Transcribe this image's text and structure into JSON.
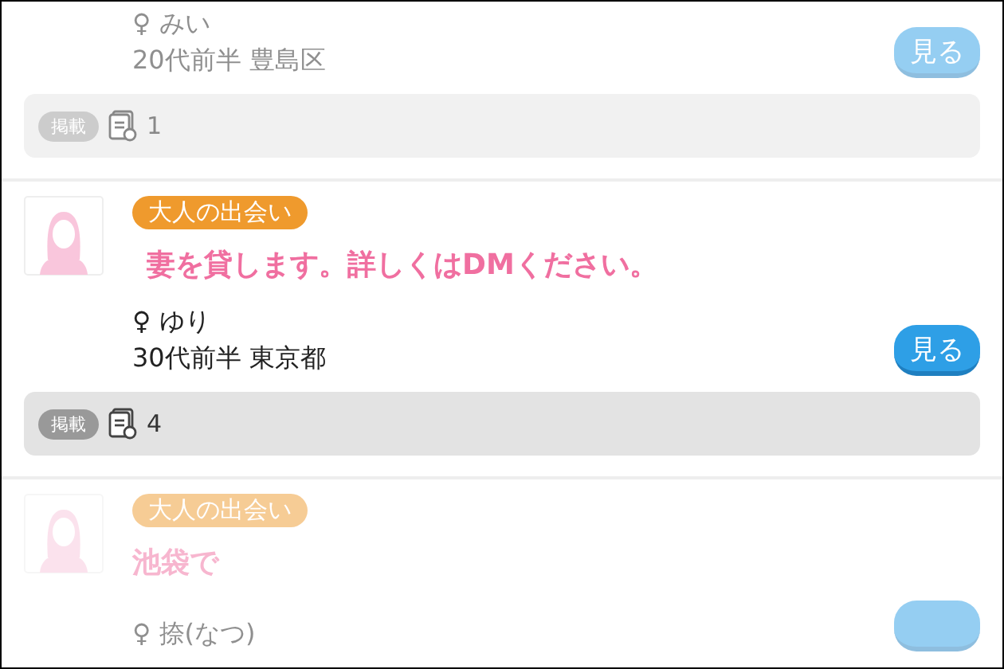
{
  "posts": [
    {
      "dimmed": true,
      "name": "♀ みい",
      "age_area": "20代前半 豊島区",
      "view_button": "見る",
      "footer": {
        "badge": "掲載",
        "count": "1"
      }
    },
    {
      "dimmed": false,
      "tag": "大人の出会い",
      "title": "妻を貸します。詳しくはDMください。",
      "name": "♀ ゆり",
      "age_area": "30代前半 東京都",
      "view_button": "見る",
      "footer": {
        "badge": "掲載",
        "count": "4"
      }
    },
    {
      "dimmed": true,
      "tag": "大人の出会い",
      "title": "池袋で",
      "name": "♀ 捺(なつ)"
    }
  ]
}
